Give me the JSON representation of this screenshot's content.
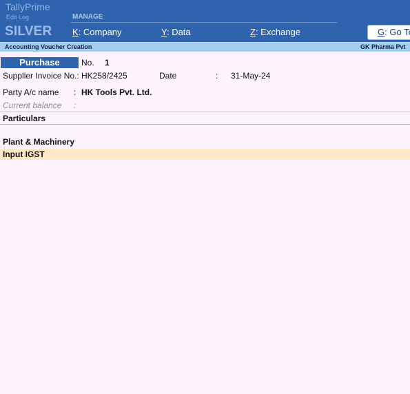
{
  "app": {
    "brand": "TallyPrime",
    "edit_log": "Edit Log",
    "edition": "SILVER"
  },
  "header": {
    "group_label": "MANAGE",
    "menu": [
      {
        "key": "K",
        "rest": ": Company"
      },
      {
        "key": "Y",
        "rest": ": Data"
      },
      {
        "key": "Z",
        "rest": ": Exchange"
      }
    ],
    "goto": {
      "key": "G",
      "rest": ": Go To"
    }
  },
  "subheader": {
    "screen_title": "Accounting Voucher Creation",
    "company": "GK Pharma Pvt"
  },
  "voucher": {
    "type": "Purchase",
    "no_label": "No.",
    "no_value": "1",
    "supplier_invoice_label": "Supplier Invoice No.:",
    "supplier_invoice_value": "HK258/2425",
    "date_label": "Date",
    "date_colon": ":",
    "date_value": "31-May-24",
    "party_label": "Party A/c name",
    "party_colon": ":",
    "party_value": "HK Tools Pvt. Ltd.",
    "balance_label": "Current balance",
    "balance_colon": ":"
  },
  "particulars": {
    "header": "Particulars",
    "rows": [
      "Plant & Machinery",
      "Input IGST"
    ]
  }
}
